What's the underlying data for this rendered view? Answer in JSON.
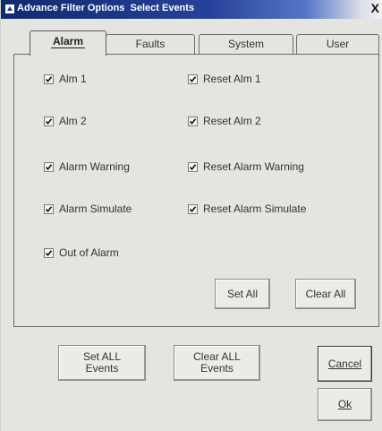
{
  "window": {
    "title": "Advance Filter Options  Select Events",
    "close_label": "X"
  },
  "tabs": [
    {
      "label": "Alarm",
      "active": true
    },
    {
      "label": "Faults",
      "active": false
    },
    {
      "label": "System",
      "active": false
    },
    {
      "label": "User",
      "active": false
    }
  ],
  "checkboxes": [
    {
      "label": "Alm 1",
      "checked": true
    },
    {
      "label": "Reset Alm 1",
      "checked": true
    },
    {
      "label": "Alm 2",
      "checked": true
    },
    {
      "label": "Reset Alm 2",
      "checked": true
    },
    {
      "label": "Alarm Warning",
      "checked": true
    },
    {
      "label": "Reset Alarm Warning",
      "checked": true
    },
    {
      "label": "Alarm Simulate",
      "checked": true
    },
    {
      "label": "Reset Alarm Simulate",
      "checked": true
    },
    {
      "label": "Out of Alarm",
      "checked": true
    }
  ],
  "panel_buttons": {
    "set_all": "Set All",
    "clear_all": "Clear All"
  },
  "footer_buttons": {
    "set_all_events_line1": "Set ALL",
    "set_all_events_line2": "Events",
    "clear_all_events_line1": "Clear ALL",
    "clear_all_events_line2": "Events",
    "cancel": "Cancel",
    "ok": "Ok"
  }
}
